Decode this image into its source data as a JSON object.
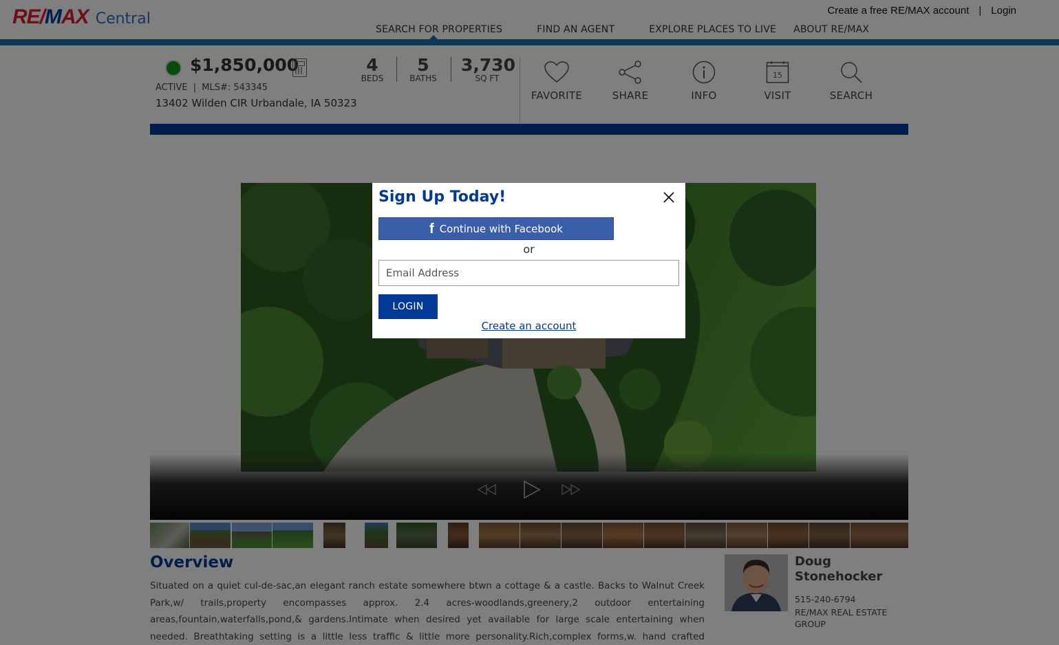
{
  "header": {
    "logo_text": "RE/MAX",
    "logo_sub": "Central",
    "top_links": {
      "create_account": "Create a free RE/MAX account",
      "separator": "|",
      "login": "Login"
    },
    "nav": [
      "SEARCH FOR PROPERTIES",
      "FIND AN AGENT",
      "EXPLORE PLACES TO LIVE",
      "ABOUT RE/MAX"
    ],
    "accent_color": "#1c6fa8"
  },
  "listing": {
    "status_color": "#0b9a16",
    "price": "$1,850,000",
    "status": "ACTIVE",
    "mls_label": "MLS#: 543345",
    "address": "13402 Wilden CIR Urbandale, IA 50323",
    "beds": {
      "value": "4",
      "label": "BEDS"
    },
    "baths": {
      "value": "5",
      "label": "BATHS"
    },
    "sqft": {
      "value": "3,730",
      "label": "SQ FT"
    },
    "actions": [
      {
        "label": "FAVORITE",
        "icon": "heart-icon"
      },
      {
        "label": "SHARE",
        "icon": "share-icon"
      },
      {
        "label": "INFO",
        "icon": "info-icon"
      },
      {
        "label": "VISIT",
        "icon": "calendar-icon",
        "icon_text": "15"
      },
      {
        "label": "SEARCH",
        "icon": "search-icon"
      }
    ],
    "band_color": "#003a96"
  },
  "gallery": {
    "controls": [
      "rewind-icon",
      "play-icon",
      "fast-forward-icon"
    ],
    "thumbnail_count": 20
  },
  "overview": {
    "title": "Overview",
    "text": "Situated on a quiet cul-de-sac,an elegant ranch estate somewhere btwn a cottage & a castle. Backs to Walnut Creek Park,w/ trails,property encompasses approx. 2.4 acres-woodlands,greenery,2 outdoor entertaining areas,fountain,waterfalls,pond,& gardens.Intimate when desired yet available for large scale entertaining when needed. Breathtaking setting is a little less traffic & little more personality.Rich,complex forms,w. hand crafted distressed alder woodwork & walnut flooring,plaster,custom"
  },
  "agent": {
    "name": "Doug Stonehocker",
    "phone": "515-240-6794",
    "office": "RE/MAX REAL ESTATE GROUP"
  },
  "modal": {
    "title": "Sign Up Today!",
    "facebook_button": "Continue with Facebook",
    "or_text": "or",
    "email_placeholder": "Email Address",
    "login_button": "LOGIN",
    "create_account_link": "Create an account",
    "facebook_color": "#3b5ea8"
  }
}
